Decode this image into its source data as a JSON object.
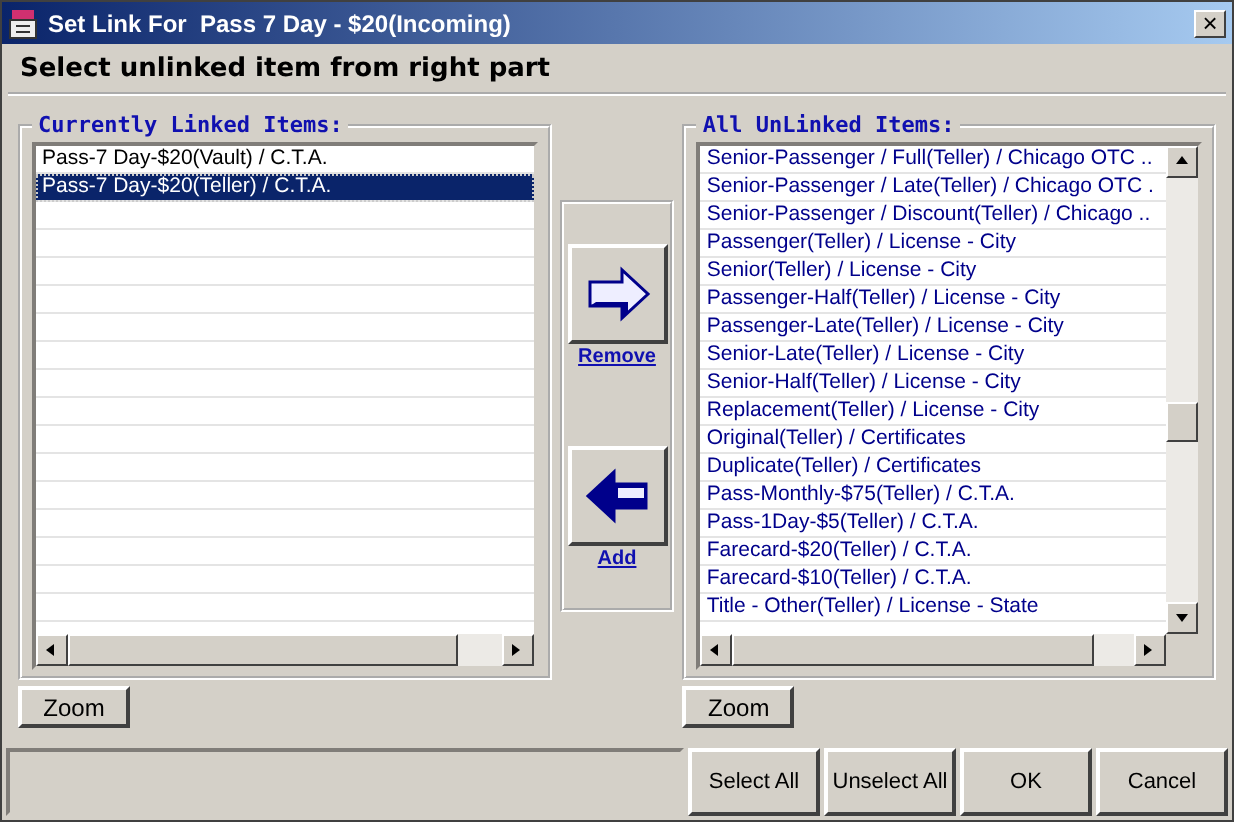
{
  "window": {
    "title": "Set Link For  Pass 7 Day - $20(Incoming)",
    "close": "×"
  },
  "instruction": "Select unlinked item from right part",
  "linked": {
    "label": "Currently Linked Items:",
    "items": [
      {
        "text": "Pass-7 Day-$20(Vault) / C.T.A.",
        "selected": false
      },
      {
        "text": "Pass-7 Day-$20(Teller) / C.T.A.",
        "selected": true
      }
    ],
    "zoom": "Zoom"
  },
  "actions": [
    {
      "kind": "right",
      "label": "Remove"
    },
    {
      "kind": "left",
      "label": "Add"
    }
  ],
  "unlinked": {
    "label": "All UnLinked Items:",
    "items": [
      {
        "text": "Senior-Passenger / Full(Teller) / Chicago OTC ..",
        "selected": false
      },
      {
        "text": "Senior-Passenger / Late(Teller) / Chicago OTC .",
        "selected": false
      },
      {
        "text": "Senior-Passenger / Discount(Teller) / Chicago ..",
        "selected": false
      },
      {
        "text": "Passenger(Teller) / License - City",
        "selected": false
      },
      {
        "text": "Senior(Teller) / License - City",
        "selected": false
      },
      {
        "text": "Passenger-Half(Teller) / License - City",
        "selected": false
      },
      {
        "text": "Passenger-Late(Teller) / License - City",
        "selected": false
      },
      {
        "text": "Senior-Late(Teller) / License - City",
        "selected": false
      },
      {
        "text": "Senior-Half(Teller) / License - City",
        "selected": false
      },
      {
        "text": "Replacement(Teller) / License - City",
        "selected": false
      },
      {
        "text": "Original(Teller) / Certificates",
        "selected": false
      },
      {
        "text": "Duplicate(Teller) / Certificates",
        "selected": false
      },
      {
        "text": "Pass-Monthly-$75(Teller) / C.T.A.",
        "selected": false
      },
      {
        "text": "Pass-1Day-$5(Teller) / C.T.A.",
        "selected": false
      },
      {
        "text": "Farecard-$20(Teller) / C.T.A.",
        "selected": false
      },
      {
        "text": "Farecard-$10(Teller) / C.T.A.",
        "selected": false
      },
      {
        "text": "Title - Other(Teller) / License - State",
        "selected": false
      }
    ],
    "zoom": "Zoom"
  },
  "buttons": [
    "Select All",
    "Unselect All",
    "OK",
    "Cancel"
  ]
}
